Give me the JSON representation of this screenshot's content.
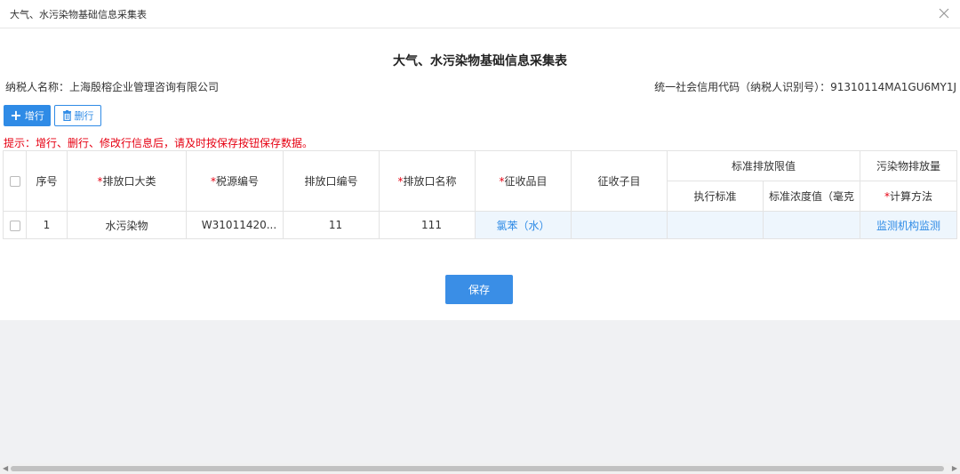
{
  "window": {
    "title": "大气、水污染物基础信息采集表"
  },
  "form": {
    "title": "大气、水污染物基础信息采集表",
    "taxpayer_name": "纳税人名称：上海殷榕企业管理咨询有限公司",
    "credit_code": "统一社会信用代码（纳税人识别号）：91310114MA1GU6MY1J"
  },
  "toolbar": {
    "add_label": "增行",
    "delete_label": "删行"
  },
  "hint": "提示：增行、删行、修改行信息后，请及时按保存按钮保存数据。",
  "table": {
    "headers": {
      "seq": "序号",
      "outlet_category": "排放口大类",
      "tax_source_no": "税源编号",
      "outlet_no": "排放口编号",
      "outlet_name": "排放口名称",
      "tax_item": "征收品目",
      "tax_subitem": "征收子目",
      "std_limit_group": "标准排放限值",
      "exec_standard": "执行标准",
      "std_concentration": "标准浓度值（毫克",
      "pollutant_group": "污染物排放量",
      "calc_method": "计算方法"
    },
    "rows": [
      {
        "seq": "1",
        "outlet_category": "水污染物",
        "tax_source_no": "W31011420...",
        "outlet_no": "11",
        "outlet_name": "111",
        "tax_item": "氯苯（水）",
        "tax_subitem": "",
        "exec_standard": "",
        "std_concentration": "",
        "calc_method": "监测机构监测"
      }
    ]
  },
  "actions": {
    "save_label": "保存"
  },
  "colors": {
    "primary": "#2f8be6",
    "required": "#e60012",
    "hint": "#e60012",
    "cell_tint": "#eef6fd"
  }
}
